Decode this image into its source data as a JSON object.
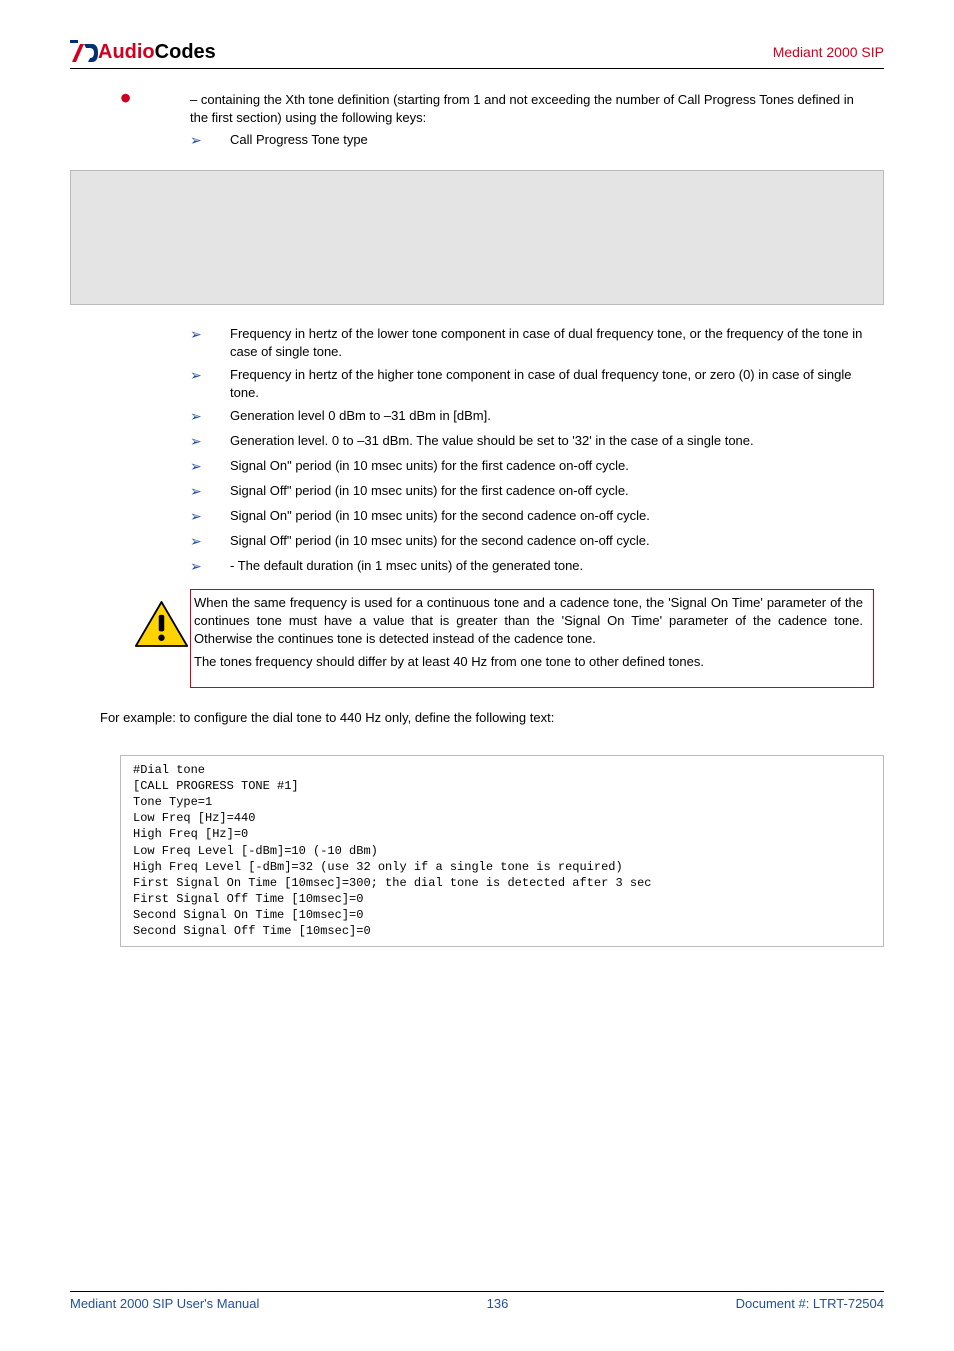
{
  "header": {
    "logo_audio": "Audio",
    "logo_codes": "Codes",
    "product": "Mediant 2000 SIP"
  },
  "main": {
    "bullet": " – containing the Xth tone definition (starting from 1 and not exceeding the number of Call Progress Tones defined in the first section) using the following keys:",
    "sub_tonetype": " Call Progress Tone type",
    "sub_lowfreq": " Frequency in hertz of the lower tone component in case of dual frequency tone, or the frequency of the tone in case of single tone.",
    "sub_highfreq": " Frequency in hertz of the higher tone component in case of dual frequency tone, or zero (0) in case of single tone.",
    "sub_genlevel1": " Generation level 0 dBm to –31 dBm in [dBm].",
    "sub_genlevel2": " Generation level. 0 to –31 dBm. The value should be set to '32' in the case of a single tone.",
    "sub_sigon1": " Signal On\" period (in 10 msec units) for the first cadence on-off cycle.",
    "sub_sigoff1": " Signal Off\" period (in 10 msec units) for the first cadence on-off cycle.",
    "sub_sigon2": " Signal On\" period (in 10 msec units) for the second cadence on-off cycle.",
    "sub_sigoff2": " Signal Off\" period (in 10 msec units) for the second cadence on-off cycle.",
    "sub_default": " - The default duration (in 1 msec units) of the generated tone.",
    "note_p1": "When the same frequency is used for a continuous tone and a cadence tone, the 'Signal On Time' parameter of the continues tone must have a value that is greater than the 'Signal On Time' parameter of the cadence tone. Otherwise the continues tone is detected instead of the cadence tone.",
    "note_p2": "The tones frequency should differ by at least 40 Hz from one tone to other defined tones.",
    "example": "For example: to configure the dial tone to 440 Hz only, define the following text:",
    "code": "#Dial tone\n[CALL PROGRESS TONE #1]\nTone Type=1\nLow Freq [Hz]=440\nHigh Freq [Hz]=0\nLow Freq Level [-dBm]=10 (-10 dBm)\nHigh Freq Level [-dBm]=32 (use 32 only if a single tone is required)\nFirst Signal On Time [10msec]=300; the dial tone is detected after 3 sec\nFirst Signal Off Time [10msec]=0\nSecond Signal On Time [10msec]=0\nSecond Signal Off Time [10msec]=0"
  },
  "footer": {
    "left": "Mediant 2000 SIP User's Manual",
    "center": "136",
    "right": "Document #: LTRT-72504"
  }
}
